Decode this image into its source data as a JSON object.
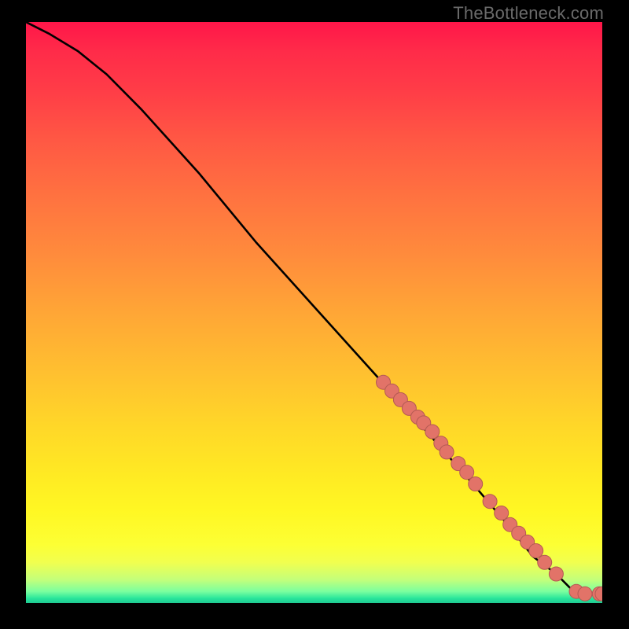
{
  "watermark": "TheBottleneck.com",
  "colors": {
    "background": "#000000",
    "curve": "#000000",
    "marker_fill": "#e27368",
    "marker_stroke": "#b45a53",
    "watermark": "#6a6a6a"
  },
  "chart_data": {
    "type": "line",
    "title": "",
    "xlabel": "",
    "ylabel": "",
    "xlim": [
      0,
      100
    ],
    "ylim": [
      0,
      100
    ],
    "grid": false,
    "legend": false,
    "series": [
      {
        "name": "curve",
        "style": "line",
        "x": [
          0,
          4,
          9,
          14,
          20,
          30,
          40,
          50,
          60,
          70,
          78,
          84,
          88,
          92,
          95,
          98,
          100
        ],
        "y": [
          100,
          98,
          95,
          91,
          85,
          74,
          62,
          51,
          40,
          29,
          20,
          13,
          8,
          5,
          2,
          1.5,
          1.5
        ]
      },
      {
        "name": "markers",
        "style": "points",
        "x": [
          62,
          63.5,
          65,
          66.5,
          68,
          69,
          70.5,
          72,
          73,
          75,
          76.5,
          78,
          80.5,
          82.5,
          84,
          85.5,
          87,
          88.5,
          90,
          92,
          95.5,
          97,
          99.5,
          100
        ],
        "y": [
          38,
          36.5,
          35,
          33.5,
          32,
          31,
          29.5,
          27.5,
          26,
          24,
          22.5,
          20.5,
          17.5,
          15.5,
          13.5,
          12,
          10.5,
          9,
          7,
          5,
          2,
          1.6,
          1.6,
          1.6
        ]
      }
    ]
  }
}
